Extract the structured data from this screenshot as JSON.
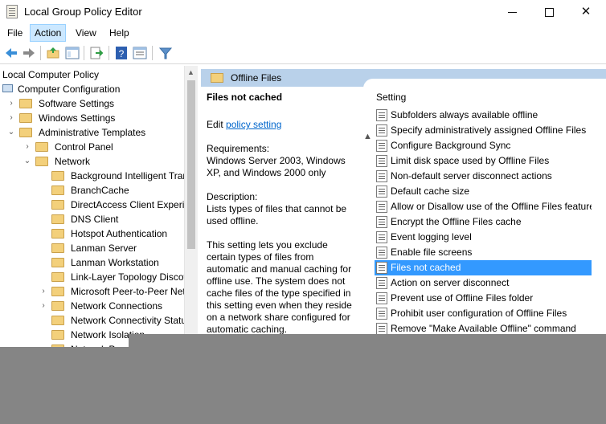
{
  "window": {
    "title": "Local Group Policy Editor"
  },
  "menu": {
    "file": "File",
    "action": "Action",
    "view": "View",
    "help": "Help"
  },
  "toolbar": {
    "buttons": [
      "back-arrow-icon",
      "forward-arrow-icon",
      "up-folder-icon",
      "show-hide-tree-icon",
      "export-list-icon",
      "help-icon",
      "properties-icon",
      "filter-icon"
    ]
  },
  "tree": {
    "items": [
      {
        "label": "Local Computer Policy",
        "indent": 0,
        "expander": "",
        "icon": "computer-icon"
      },
      {
        "label": "Computer Configuration",
        "indent": 0,
        "expander": "",
        "icon": "computer-icon"
      },
      {
        "label": "Software Settings",
        "indent": 1,
        "expander": ">",
        "icon": "folder-icon"
      },
      {
        "label": "Windows Settings",
        "indent": 1,
        "expander": ">",
        "icon": "folder-icon"
      },
      {
        "label": "Administrative Templates",
        "indent": 1,
        "expander": "v",
        "icon": "folder-icon"
      },
      {
        "label": "Control Panel",
        "indent": 2,
        "expander": ">",
        "icon": "folder-icon"
      },
      {
        "label": "Network",
        "indent": 2,
        "expander": "v",
        "icon": "folder-icon"
      },
      {
        "label": "Background Intelligent Trans",
        "indent": 3,
        "expander": "",
        "icon": "folder-icon"
      },
      {
        "label": "BranchCache",
        "indent": 3,
        "expander": "",
        "icon": "folder-icon"
      },
      {
        "label": "DirectAccess Client Experien",
        "indent": 3,
        "expander": "",
        "icon": "folder-icon"
      },
      {
        "label": "DNS Client",
        "indent": 3,
        "expander": "",
        "icon": "folder-icon"
      },
      {
        "label": "Hotspot Authentication",
        "indent": 3,
        "expander": "",
        "icon": "folder-icon"
      },
      {
        "label": "Lanman Server",
        "indent": 3,
        "expander": "",
        "icon": "folder-icon"
      },
      {
        "label": "Lanman Workstation",
        "indent": 3,
        "expander": "",
        "icon": "folder-icon"
      },
      {
        "label": "Link-Layer Topology Discove",
        "indent": 3,
        "expander": "",
        "icon": "folder-icon"
      },
      {
        "label": "Microsoft Peer-to-Peer Netw",
        "indent": 3,
        "expander": ">",
        "icon": "folder-icon"
      },
      {
        "label": "Network Connections",
        "indent": 3,
        "expander": ">",
        "icon": "folder-icon"
      },
      {
        "label": "Network Connectivity Status",
        "indent": 3,
        "expander": "",
        "icon": "folder-icon"
      },
      {
        "label": "Network Isolation",
        "indent": 3,
        "expander": "",
        "icon": "folder-icon"
      },
      {
        "label": "Network Provi",
        "indent": 3,
        "expander": "",
        "icon": "folder-icon"
      }
    ]
  },
  "right": {
    "header": "Offline Files",
    "description": {
      "title": "Files not cached",
      "edit_prefix": "Edit",
      "edit_link": "policy setting",
      "requirements_label": "Requirements:",
      "requirements_text": "Windows Server 2003, Windows XP, and Windows 2000 only",
      "description_label": "Description:",
      "description_text": "Lists types of files that cannot be used offline.",
      "body": "This setting lets you exclude certain types of files from automatic and manual caching for offline use. The system does not cache files of the type specified in this setting even when they reside on a network share configured for automatic caching."
    },
    "list_header": "Setting",
    "settings": [
      "Subfolders always available offline",
      "Specify administratively assigned Offline Files",
      "Configure Background Sync",
      "Limit disk space used by Offline Files",
      "Non-default server disconnect actions",
      "Default cache size",
      "Allow or Disallow use of the Offline Files feature",
      "Encrypt the Offline Files cache",
      "Event logging level",
      "Enable file screens",
      "Files not cached",
      "Action on server disconnect",
      "Prevent use of Offline Files folder",
      "Prohibit user configuration of Offline Files",
      "Remove \"Make Available Offline\" command"
    ],
    "selected_setting": "Files not cached"
  },
  "colors": {
    "selection": "#3399ff",
    "header_band": "#b9d1ea",
    "link": "#0066cc",
    "overlay": "#858585"
  }
}
